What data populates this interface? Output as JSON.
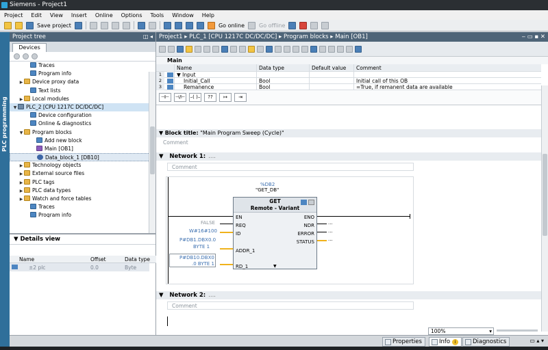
{
  "title": "Siemens  -  Project1",
  "menu": [
    "Project",
    "Edit",
    "View",
    "Insert",
    "Online",
    "Options",
    "Tools",
    "Window",
    "Help"
  ],
  "toolbar": {
    "save_label": "Save project",
    "go_online": "Go online",
    "go_offline": "Go offline"
  },
  "left_panel": {
    "vertical_label": "PLC programming",
    "tree_title": "Project tree",
    "devices_tab": "Devices",
    "items": [
      {
        "label": "Traces",
        "indent": 2,
        "icon": "blue"
      },
      {
        "label": "Program info",
        "indent": 2,
        "icon": "blue"
      },
      {
        "label": "Device proxy data",
        "indent": 1,
        "icon": "folder",
        "arrow": "▶"
      },
      {
        "label": "Text lists",
        "indent": 2,
        "icon": "blue"
      },
      {
        "label": "Local modules",
        "indent": 1,
        "icon": "folder",
        "arrow": "▶"
      },
      {
        "label": "PLC_2 [CPU 1217C DC/DC/DC]",
        "indent": 0,
        "icon": "cpu",
        "arrow": "▼",
        "state": "selected"
      },
      {
        "label": "Device configuration",
        "indent": 2,
        "icon": "blue"
      },
      {
        "label": "Online & diagnostics",
        "indent": 2,
        "icon": "blue"
      },
      {
        "label": "Program blocks",
        "indent": 1,
        "icon": "folder",
        "arrow": "▼"
      },
      {
        "label": "Add new block",
        "indent": 3,
        "icon": "blue"
      },
      {
        "label": "Main [OB1]",
        "indent": 3,
        "icon": "violet"
      },
      {
        "label": "Data_block_1 [DB10]",
        "indent": 3,
        "icon": "db",
        "state": "highlight"
      },
      {
        "label": "Technology objects",
        "indent": 1,
        "icon": "folder",
        "arrow": "▶"
      },
      {
        "label": "External source files",
        "indent": 1,
        "icon": "folder",
        "arrow": "▶"
      },
      {
        "label": "PLC tags",
        "indent": 1,
        "icon": "folder",
        "arrow": "▶"
      },
      {
        "label": "PLC data types",
        "indent": 1,
        "icon": "folder",
        "arrow": "▶"
      },
      {
        "label": "Watch and force tables",
        "indent": 1,
        "icon": "folder",
        "arrow": "▶"
      },
      {
        "label": "Traces",
        "indent": 2,
        "icon": "blue"
      },
      {
        "label": "Program info",
        "indent": 2,
        "icon": "blue"
      }
    ],
    "details_title": "Details view",
    "details_columns": [
      "Name",
      "Offset",
      "Data type"
    ],
    "details_row": {
      "name": "±2 plc",
      "offset": "0.0",
      "type": "Byte"
    }
  },
  "editor": {
    "breadcrumb": "Project1  ▸  PLC_1 [CPU 1217C DC/DC/DC]  ▸  Program blocks  ▸  Main [OB1]",
    "main_label": "Main",
    "interface_columns": [
      "Name",
      "Data type",
      "Default value",
      "Comment"
    ],
    "interface_rows": [
      {
        "num": "1",
        "name": "▼ Input",
        "type": "",
        "comment": ""
      },
      {
        "num": "2",
        "name": "Initial_Call",
        "type": "Bool",
        "comment": "Initial call of this OB"
      },
      {
        "num": "3",
        "name": "Remanence",
        "type": "Bool",
        "comment": "=True, if remanent data are available"
      }
    ],
    "block_title_label": "Block title:",
    "block_title_value": "\"Main Program Sweep (Cycle)\"",
    "comment_placeholder": "Comment",
    "network1": "Network 1:",
    "network1_dots": "....",
    "network2": "Network 2:",
    "network2_dots": "....",
    "fb": {
      "instance": "%DB2",
      "instance_name": "\"GET_DB\"",
      "name": "GET",
      "subtitle": "Remote  -  Variant",
      "inputs": [
        "EN",
        "REQ",
        "ID",
        "ADDR_1",
        "RD_1"
      ],
      "outputs": [
        "ENO",
        "NDR",
        "ERROR",
        "STATUS"
      ],
      "req_value": "FALSE",
      "id_value": "W#16#100",
      "addr_value_line1": "P#DB1.DBX0.0",
      "addr_value_line2": "BYTE 1",
      "rd_value_line1": "P#DB10.DBX0",
      "rd_value_line2": ".0 BYTE 1",
      "out_placeholder": "..."
    },
    "zoom": "100%"
  },
  "bottom_tabs": {
    "properties": "Properties",
    "info": "Info",
    "diagnostics": "Diagnostics",
    "info_badge": "i"
  }
}
